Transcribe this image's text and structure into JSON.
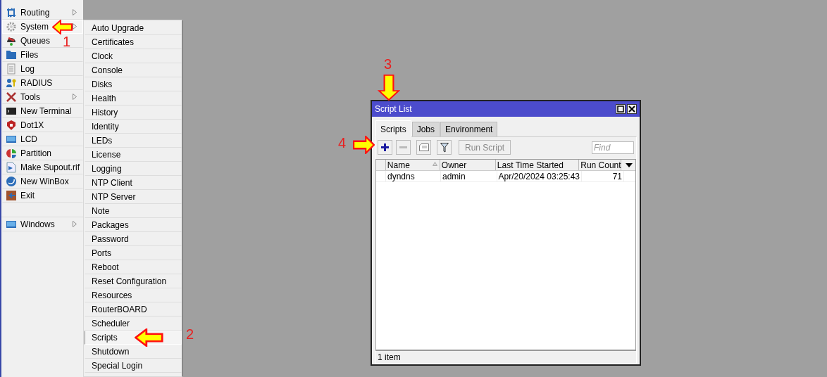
{
  "sidebar": {
    "items": [
      {
        "label": "Routing",
        "has_submenu": true,
        "selected": false
      },
      {
        "label": "System",
        "has_submenu": true,
        "selected": true
      },
      {
        "label": "Queues",
        "has_submenu": false,
        "selected": false
      },
      {
        "label": "Files",
        "has_submenu": false,
        "selected": false
      },
      {
        "label": "Log",
        "has_submenu": false,
        "selected": false
      },
      {
        "label": "RADIUS",
        "has_submenu": false,
        "selected": false
      },
      {
        "label": "Tools",
        "has_submenu": true,
        "selected": false
      },
      {
        "label": "New Terminal",
        "has_submenu": false,
        "selected": false
      },
      {
        "label": "Dot1X",
        "has_submenu": false,
        "selected": false
      },
      {
        "label": "LCD",
        "has_submenu": false,
        "selected": false
      },
      {
        "label": "Partition",
        "has_submenu": false,
        "selected": false
      },
      {
        "label": "Make Supout.rif",
        "has_submenu": false,
        "selected": false
      },
      {
        "label": "New WinBox",
        "has_submenu": false,
        "selected": false
      },
      {
        "label": "Exit",
        "has_submenu": false,
        "selected": false
      }
    ],
    "bottom_items": [
      {
        "label": "Windows",
        "has_submenu": true,
        "selected": false
      }
    ]
  },
  "submenu": {
    "items": [
      {
        "label": "Auto Upgrade",
        "selected": false
      },
      {
        "label": "Certificates",
        "selected": false
      },
      {
        "label": "Clock",
        "selected": false
      },
      {
        "label": "Console",
        "selected": false
      },
      {
        "label": "Disks",
        "selected": false
      },
      {
        "label": "Health",
        "selected": false
      },
      {
        "label": "History",
        "selected": false
      },
      {
        "label": "Identity",
        "selected": false
      },
      {
        "label": "LEDs",
        "selected": false
      },
      {
        "label": "License",
        "selected": false
      },
      {
        "label": "Logging",
        "selected": false
      },
      {
        "label": "NTP Client",
        "selected": false
      },
      {
        "label": "NTP Server",
        "selected": false
      },
      {
        "label": "Note",
        "selected": false
      },
      {
        "label": "Packages",
        "selected": false
      },
      {
        "label": "Password",
        "selected": false
      },
      {
        "label": "Ports",
        "selected": false
      },
      {
        "label": "Reboot",
        "selected": false
      },
      {
        "label": "Reset Configuration",
        "selected": false
      },
      {
        "label": "Resources",
        "selected": false
      },
      {
        "label": "RouterBOARD",
        "selected": false
      },
      {
        "label": "Scheduler",
        "selected": false
      },
      {
        "label": "Scripts",
        "selected": true
      },
      {
        "label": "Shutdown",
        "selected": false
      },
      {
        "label": "Special Login",
        "selected": false
      }
    ]
  },
  "window": {
    "title": "Script List",
    "tabs": [
      {
        "label": "Scripts",
        "selected": true
      },
      {
        "label": "Jobs",
        "selected": false
      },
      {
        "label": "Environment",
        "selected": false
      }
    ],
    "toolbar": {
      "run_button": {
        "label": "Run Script",
        "disabled": true
      },
      "remove_disabled": true,
      "search": {
        "placeholder": "Find"
      }
    },
    "table": {
      "columns": [
        {
          "label": "Name",
          "sorted": true
        },
        {
          "label": "Owner",
          "sorted": false
        },
        {
          "label": "Last Time Started",
          "sorted": false
        },
        {
          "label": "Run Count",
          "sorted": false
        }
      ],
      "rows": [
        [
          "dyndns",
          "admin",
          "Apr/20/2024 03:25:43",
          "71"
        ]
      ]
    },
    "status_bar": "1 item"
  },
  "annotations": [
    {
      "label": "1",
      "kind": "left"
    },
    {
      "label": "2",
      "kind": "left"
    },
    {
      "label": "3",
      "kind": "down"
    },
    {
      "label": "4",
      "kind": "right"
    }
  ]
}
